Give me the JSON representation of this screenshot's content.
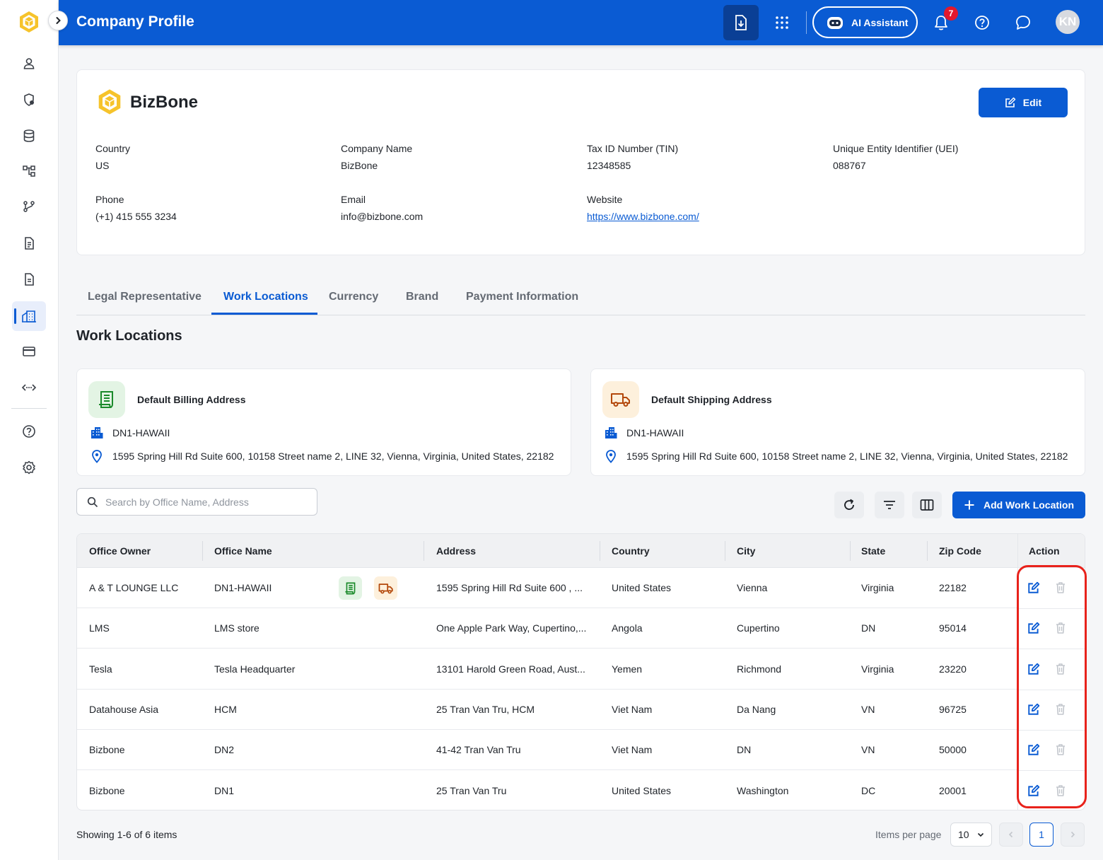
{
  "colors": {
    "primary": "#0a5bd3",
    "highlight": "#e8221b",
    "billing_bg": "#e3f4e4",
    "billing_icon": "#1a8a2a",
    "shipping_bg": "#fdf0dc",
    "shipping_icon": "#b3470a"
  },
  "topbar": {
    "title": "Company Profile",
    "ai_assistant_label": "AI Assistant",
    "notification_count": "7",
    "avatar_initials": "KN",
    "icons": [
      "download-icon",
      "apps-grid-icon",
      "robot-icon",
      "bell-icon",
      "help-icon",
      "chat-icon"
    ]
  },
  "sidebar": {
    "icons": [
      "user-icon",
      "shield-icon",
      "database-icon",
      "hierarchy-icon",
      "workflow-icon",
      "document-icon",
      "file-icon",
      "company-icon",
      "card-icon",
      "api-icon",
      "help-icon",
      "settings-icon"
    ],
    "active": "company-icon"
  },
  "company": {
    "name": "BizBone",
    "edit_label": "Edit",
    "fields": {
      "country": {
        "label": "Country",
        "value": "US"
      },
      "company_name": {
        "label": "Company Name",
        "value": "BizBone"
      },
      "tin": {
        "label": "Tax ID Number (TIN)",
        "value": "12348585"
      },
      "uei": {
        "label": "Unique Entity Identifier (UEI)",
        "value": "088767"
      },
      "phone": {
        "label": "Phone",
        "value": "(+1) 415 555 3234"
      },
      "email": {
        "label": "Email",
        "value": "info@bizbone.com"
      },
      "website": {
        "label": "Website",
        "value": "https://www.bizbone.com/"
      }
    }
  },
  "tabs": [
    {
      "label": "Legal Representative"
    },
    {
      "label": "Work Locations",
      "active": true
    },
    {
      "label": "Currency"
    },
    {
      "label": "Brand"
    },
    {
      "label": "Payment Information"
    }
  ],
  "work_locations": {
    "title": "Work Locations",
    "billing": {
      "title": "Default Billing Address",
      "office": "DN1-HAWAII",
      "address": "1595 Spring Hill Rd Suite 600, 10158 Street name 2, LINE 32, Vienna, Virginia, United States, 22182"
    },
    "shipping": {
      "title": "Default Shipping Address",
      "office": "DN1-HAWAII",
      "address": "1595 Spring Hill Rd Suite 600, 10158 Street name 2, LINE 32, Vienna, Virginia, United States, 22182"
    },
    "search_placeholder": "Search by Office Name, Address",
    "add_label": "Add Work Location",
    "columns": [
      "Office Owner",
      "Office Name",
      "Address",
      "Country",
      "City",
      "State",
      "Zip Code",
      "Action"
    ],
    "rows": [
      {
        "owner": "A & T LOUNGE LLC",
        "office": "DN1-HAWAII",
        "address": "1595 Spring Hill Rd Suite 600 , ...",
        "country": "United States",
        "city": "Vienna",
        "state": "Virginia",
        "zip": "22182",
        "default_badges": true
      },
      {
        "owner": "LMS",
        "office": "LMS store",
        "address": "One Apple Park Way, Cupertino,...",
        "country": "Angola",
        "city": "Cupertino",
        "state": "DN",
        "zip": "95014"
      },
      {
        "owner": "Tesla",
        "office": "Tesla Headquarter",
        "address": "13101 Harold Green Road, Aust...",
        "country": "Yemen",
        "city": "Richmond",
        "state": "Virginia",
        "zip": "23220"
      },
      {
        "owner": "Datahouse Asia",
        "office": "HCM",
        "address": "25 Tran Van Tru, HCM",
        "country": "Viet Nam",
        "city": "Da Nang",
        "state": "VN",
        "zip": "96725"
      },
      {
        "owner": "Bizbone",
        "office": "DN2",
        "address": "41-42 Tran Van Tru",
        "country": "Viet Nam",
        "city": "DN",
        "state": "VN",
        "zip": "50000"
      },
      {
        "owner": "Bizbone",
        "office": "DN1",
        "address": "25 Tran Van Tru",
        "country": "United States",
        "city": "Washington",
        "state": "DC",
        "zip": "20001"
      }
    ]
  },
  "pagination": {
    "showing": "Showing 1-6 of 6 items",
    "items_per_page_label": "Items per page",
    "items_per_page": "10",
    "current_page": "1"
  }
}
